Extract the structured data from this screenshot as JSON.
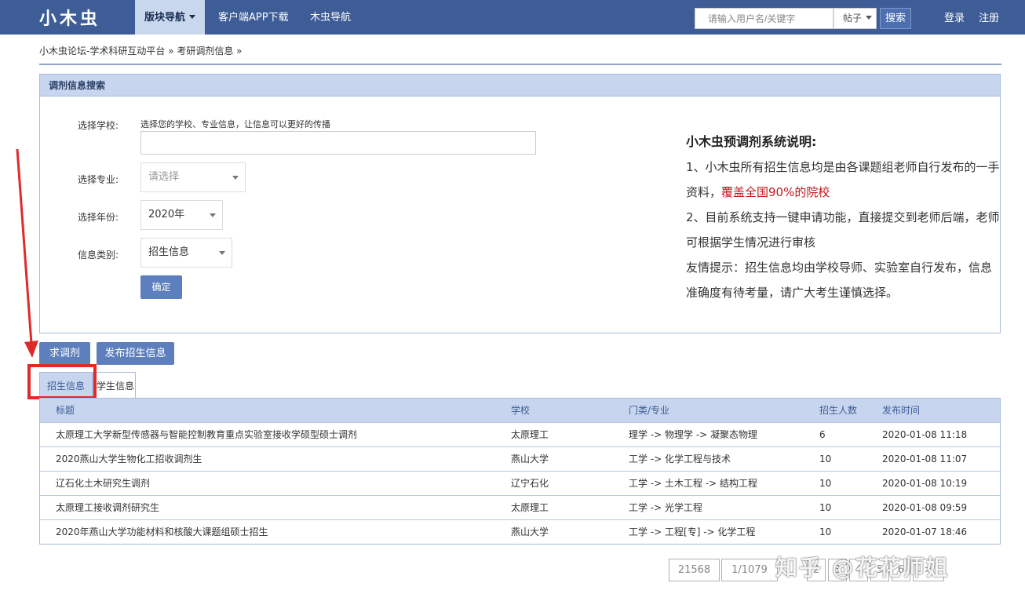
{
  "header": {
    "logo": "小木虫",
    "nav": [
      "版块导航",
      "客户端APP下载",
      "木虫导航"
    ],
    "search_placeholder": "请输入用户名/关键字",
    "search_type": "帖子",
    "search_button": "搜索",
    "login": "登录",
    "register": "注册"
  },
  "breadcrumb": [
    "小木虫论坛-学术科研互动平台",
    "考研调剂信息"
  ],
  "panel": {
    "title": "调剂信息搜索",
    "school_label": "选择学校:",
    "school_hint": "选择您的学校、专业信息，让信息可以更好的传播",
    "major_label": "选择专业:",
    "major_placeholder": "请选择",
    "year_label": "选择年份:",
    "year_value": "2020年",
    "type_label": "信息类别:",
    "type_value": "招生信息",
    "confirm": "确定"
  },
  "info": {
    "title": "小木虫预调剂系统说明:",
    "line1": "1、小木虫所有招生信息均是由各课题组老师自行发布的一手资料，",
    "line1_red": "覆盖全国90%的院校",
    "line2": "2、目前系统支持一键申请功能，直接提交到老师后端，老师可根据学生情况进行审核",
    "line3": "友情提示：招生信息均由学校导师、实验室自行发布，信息准确度有待考量，请广大考生谨慎选择。"
  },
  "actions": {
    "seek": "求调剂",
    "publish": "发布招生信息"
  },
  "tabs": {
    "active": "招生信息",
    "inactive": "学生信息"
  },
  "table": {
    "headers": [
      "标题",
      "学校",
      "门类/专业",
      "招生人数",
      "发布时间"
    ],
    "rows": [
      [
        "太原理工大学新型传感器与智能控制教育重点实验室接收学硕型硕士调剂",
        "太原理工",
        "理学 -> 物理学 -> 凝聚态物理",
        "6",
        "2020-01-08 11:18"
      ],
      [
        "2020燕山大学生物化工招收调剂生",
        "燕山大学",
        "工学 -> 化学工程与技术",
        "10",
        "2020-01-08 11:07"
      ],
      [
        "辽石化土木研究生调剂",
        "辽宁石化",
        "工学 -> 土木工程 -> 结构工程",
        "10",
        "2020-01-08 10:19"
      ],
      [
        "太原理工接收调剂研究生",
        "太原理工",
        "工学 -> 光学工程",
        "10",
        "2020-01-08 09:59"
      ],
      [
        "2020年燕山大学功能材料和核酸大课题组硕士招生",
        "燕山大学",
        "工学 -> 工程[专] -> 化学工程",
        "10",
        "2020-01-07 18:46"
      ]
    ]
  },
  "pagination": {
    "total": "21568",
    "pages": "1/1079",
    "numbers": [
      "2",
      "3",
      "4",
      "5",
      "6"
    ],
    "next": ">"
  },
  "watermark": "知乎 @花花师姐",
  "colors": {
    "nav_bg": "#3e5d96",
    "accent": "#5d7fbd",
    "highlight_red": "#e02a2a"
  }
}
